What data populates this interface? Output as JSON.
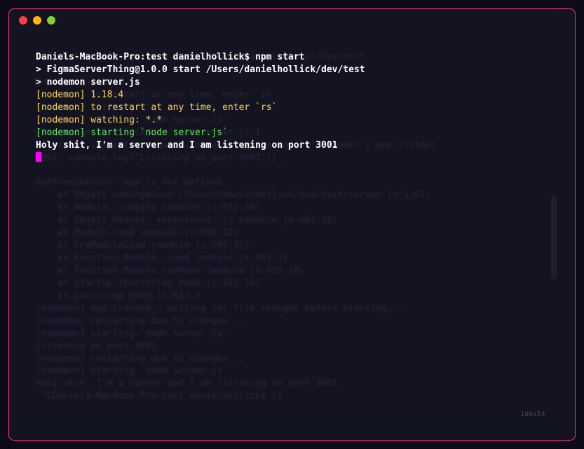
{
  "traffic": {
    "close": "close-window-dot",
    "min": "minimize-window-dot",
    "max": "maximize-window-dot"
  },
  "fg": {
    "prompt": "Daniels-MacBook-Pro:test danielhollick$ npm start",
    "blank1": "",
    "start1": "> FigmaServerThing@1.0.0 start /Users/danielhollick/dev/test",
    "start2": "> nodemon server.js",
    "blank2": "",
    "nm1_tag": "[nodemon]",
    "nm1_rest": " 1.18.4",
    "nm2_tag": "[nodemon]",
    "nm2_rest": " to restart at any time, enter `rs`",
    "nm3_tag": "[nodemon]",
    "nm3_rest": " watching: *.*",
    "nm4_tag": "[nodemon]",
    "nm4_rest": " starting `node server.js`",
    "listening": "Holy shit, I'm a server and I am listening on port 3001"
  },
  "sb": {
    "l0": "> FigmaServerThing@1.0.0 start /Users/danielhollick/dev/test",
    "l1": "> nodemon server.js",
    "l2": "",
    "l3": "[nodemon] 1.18.4",
    "l4": "[nodemon] to restart at any time, enter `rs`",
    "l5": "[nodemon] watching: *.*",
    "l6": "[nodemon] starting `node server.js`",
    "l7": "/Users/danielhollick/dev/test/server.js:1",
    "l8": "(function (exports, require, module, __filename, __dirname) { app.listen(",
    "l9": "3001, console.log(\"Listening on port 3001\"))",
    "l10": "                                            ^",
    "l11": "",
    "l12": "ReferenceError: app is not defined",
    "l13": "    at Object.<anonymous> (/Users/danielhollick/dev/test/server.js:1:63)",
    "l14": "    at Module._compile (module.js:652:30)",
    "l15": "    at Object.Module._extensions..js (module.js:663:10)",
    "l16": "    at Module.load (module.js:565:32)",
    "l17": "    at tryModuleLoad (module.js:505:12)",
    "l18": "    at Function.Module._load (module.js:497:3)",
    "l19": "    at Function.Module.runMain (module.js:693:10)",
    "l20": "    at startup (bootstrap_node.js:191:16)",
    "l21": "    at bootstrap_node.js:612:3",
    "l22": "[nodemon] app crashed - waiting for file changes before starting...",
    "l23": "[nodemon] restarting due to changes...",
    "l24": "[nodemon] starting `node server.js`",
    "l25": "Listening on port 3001",
    "l26": "[nodemon] restarting due to changes...",
    "l27": "[nodemon] starting `node server.js`",
    "l28": "Holy shit, I'm a server and I am listening on port 3001",
    "l29": " ^CDaniels-MacBook-Pro:test danielhollick$ []"
  },
  "clip": "180x54"
}
